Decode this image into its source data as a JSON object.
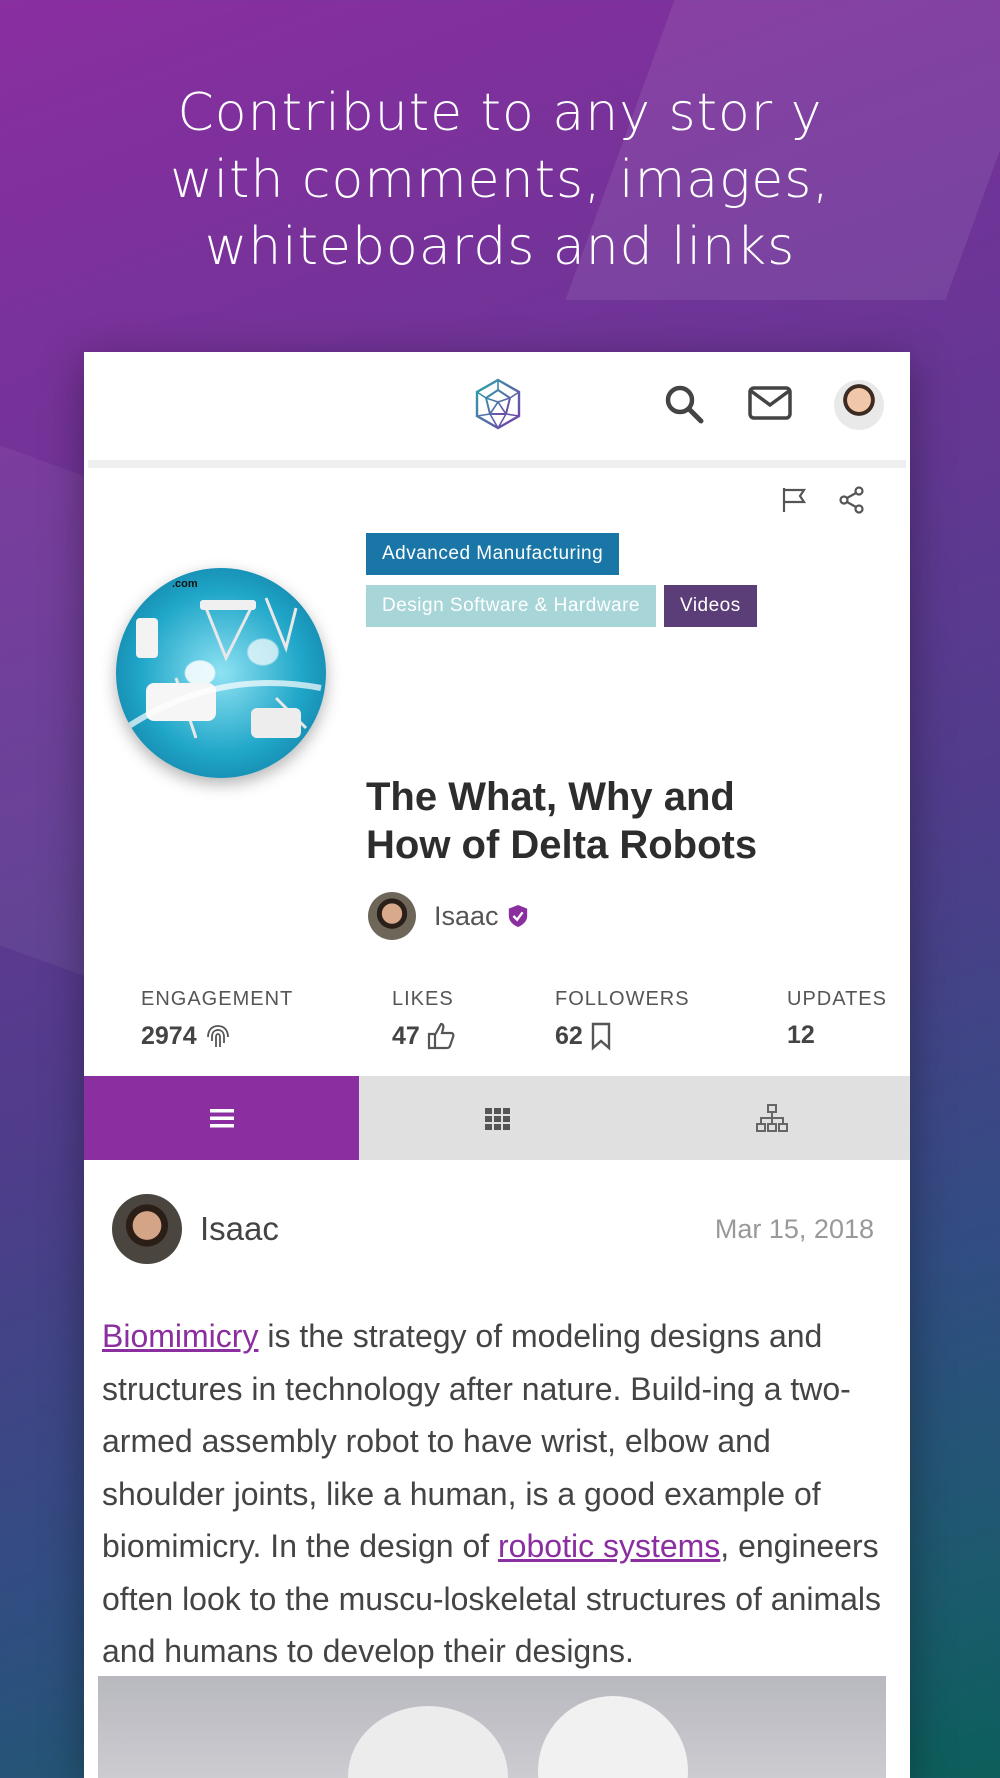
{
  "promo": {
    "headline_lines": [
      "Contribute to any stor y",
      "with comments, images,",
      "whiteboards and links"
    ]
  },
  "topbar": {
    "logo_icon": "geodesic-sphere-logo",
    "icons": [
      "search-icon",
      "mail-icon",
      "profile-avatar"
    ]
  },
  "story": {
    "actions": [
      "flag-icon",
      "share-icon"
    ],
    "tags": [
      "Advanced Manufacturing",
      "Design Software & Hardware",
      "Videos"
    ],
    "image_caption": ".com",
    "title": "The What, Why and How of Delta Robots",
    "author": "Isaac"
  },
  "stats": {
    "engagement": {
      "label": "ENGAGEMENT",
      "value": "2974"
    },
    "likes": {
      "label": "LIKES",
      "value": "47"
    },
    "followers": {
      "label": "FOLLOWERS",
      "value": "62"
    },
    "updates": {
      "label": "UPDATES",
      "value": "12"
    }
  },
  "tabs": [
    "list-icon",
    "grid-icon",
    "hierarchy-icon"
  ],
  "post": {
    "author": "Isaac",
    "date": "Mar 15, 2018",
    "link1": "Biomimicry",
    "text1": " is the strategy of modeling designs and structures in technology after nature. Build-ing a two-armed assembly robot to have wrist, elbow and shoulder joints, like a human, is a good example of biomimicry. In the design of ",
    "link2": "robotic systems",
    "text2": ", engineers often look to the muscu-loskeletal structures of animals and humans to develop their designs."
  },
  "colors": {
    "accent": "#8a2ea0",
    "tag_blue": "#1a76a6",
    "tag_teal": "#a7d5d8",
    "tag_purple": "#5b3d78"
  }
}
